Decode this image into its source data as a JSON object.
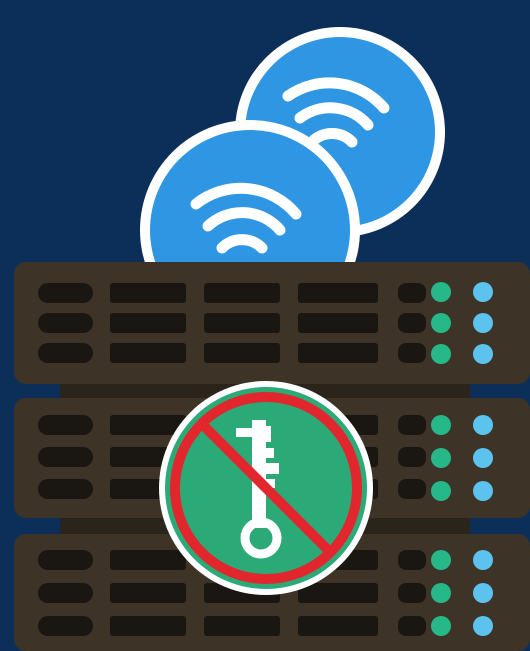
{
  "colors": {
    "background": "#0c2f5a",
    "server_body": "#3d3327",
    "server_slot": "#1a1612",
    "led_green": "#27b889",
    "led_blue": "#5bc3ee",
    "coin_fill": "#2e96e3",
    "coin_ring": "#ffffff",
    "prohibit_fill": "#2baa77",
    "prohibit_ring": "#e1262e",
    "key": "#ffffff"
  },
  "icons": {
    "coins": "contactless-coin-icon",
    "server": "server-rack-icon",
    "badge": "no-key-icon"
  }
}
